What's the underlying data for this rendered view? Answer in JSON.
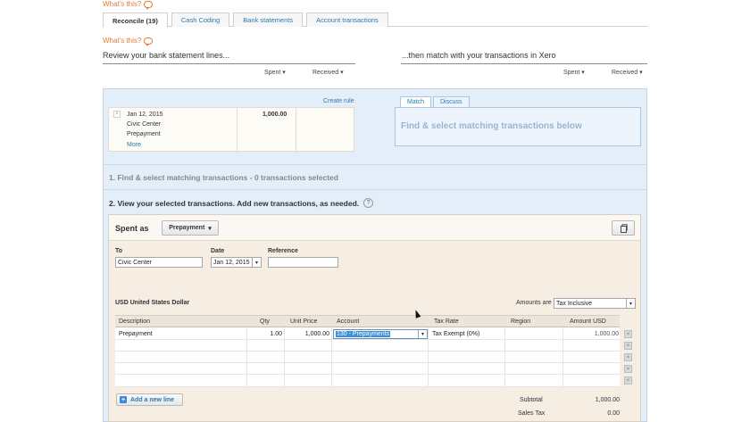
{
  "whats_this": "What's this?",
  "tabs": [
    {
      "label": "Reconcile (19)",
      "active": true
    },
    {
      "label": "Cash Coding",
      "active": false
    },
    {
      "label": "Bank statements",
      "active": false
    },
    {
      "label": "Account transactions",
      "active": false
    }
  ],
  "left_heading": "Review your bank statement lines...",
  "right_heading": "...then match with your transactions in Xero",
  "sort": {
    "spent": "Spent ▾",
    "received": "Received ▾"
  },
  "create_rule": "Create rule",
  "statement_line": {
    "date": "Jan 12, 2015",
    "payee": "Civic Center",
    "reference": "Prepayment",
    "more": "More",
    "spent": "1,000.00",
    "remove_icon": "×"
  },
  "match_tabs": {
    "match": "Match",
    "discuss": "Discuss"
  },
  "match_prompt": "Find & select matching transactions below",
  "step1": "1. Find & select matching transactions - 0 transactions selected",
  "step2": "2. View your selected transactions. Add new transactions, as needed.",
  "help_icon": "?",
  "form": {
    "spent_as_label": "Spent as",
    "spent_as_value": "Prepayment",
    "to_label": "To",
    "to_value": "Civic Center",
    "date_label": "Date",
    "date_value": "Jan 12, 2015",
    "reference_label": "Reference",
    "reference_value": "",
    "currency": "USD United States Dollar",
    "amounts_are_label": "Amounts are",
    "amounts_are_value": "Tax Inclusive",
    "dd_arrow": "▾"
  },
  "table": {
    "headers": {
      "description": "Description",
      "qty": "Qty",
      "unit_price": "Unit Price",
      "account": "Account",
      "tax_rate": "Tax Rate",
      "region": "Region",
      "amount": "Amount USD"
    },
    "rows": [
      {
        "description": "Prepayment",
        "qty": "1.00",
        "unit_price": "1,000.00",
        "account": "130 - Prepayments",
        "tax_rate": "Tax Exempt (0%)",
        "region": "",
        "amount": "1,000.00"
      }
    ],
    "delete_icon": "×"
  },
  "add_line": "Add a new line",
  "add_line_icon": "+",
  "summary": {
    "subtotal_label": "Subtotal",
    "subtotal": "1,000.00",
    "sales_tax_label": "Sales Tax",
    "sales_tax": "0.00"
  }
}
